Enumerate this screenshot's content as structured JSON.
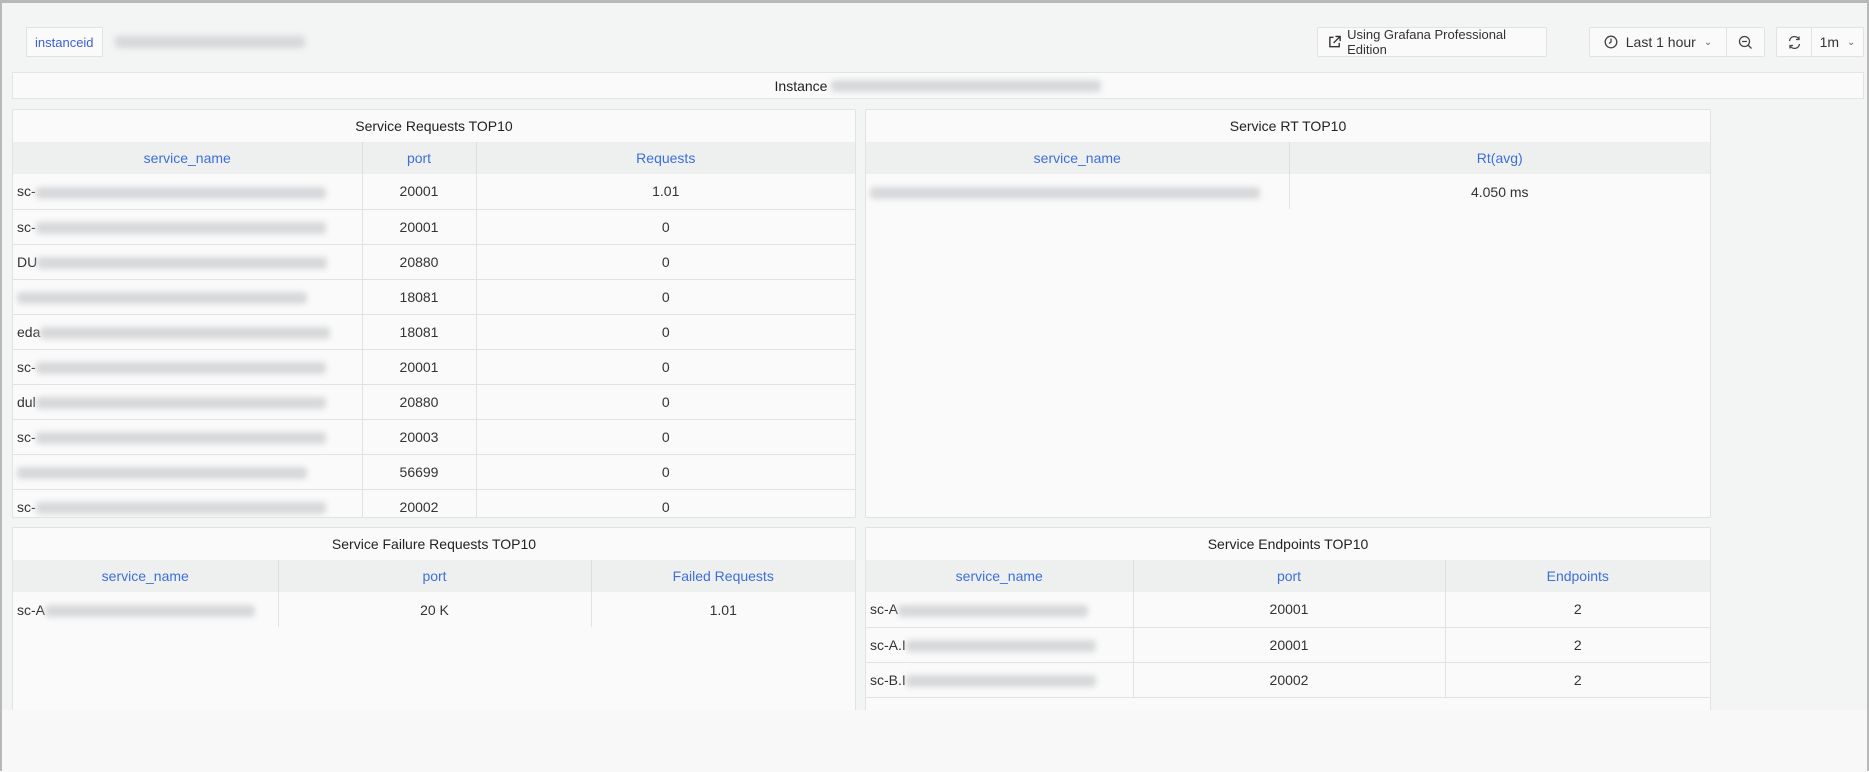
{
  "variables": {
    "label": "instanceid"
  },
  "toolbar": {
    "grafana_label": "Using Grafana Professional Edition",
    "time_range": "Last 1 hour",
    "refresh_interval": "1m"
  },
  "instance_row": {
    "label": "Instance"
  },
  "requests": {
    "title": "Service Requests TOP10",
    "headers": [
      "service_name",
      "port",
      "Requests"
    ],
    "rows": [
      {
        "prefix": "sc-",
        "port": "20001",
        "value": "1.01"
      },
      {
        "prefix": "sc-",
        "port": "20001",
        "value": "0"
      },
      {
        "prefix": "DU",
        "port": "20880",
        "value": "0"
      },
      {
        "prefix": "",
        "port": "18081",
        "value": "0"
      },
      {
        "prefix": "eda",
        "port": "18081",
        "value": "0"
      },
      {
        "prefix": "sc-",
        "port": "20001",
        "value": "0"
      },
      {
        "prefix": "dul",
        "port": "20880",
        "value": "0"
      },
      {
        "prefix": "sc-",
        "port": "20003",
        "value": "0"
      },
      {
        "prefix": "",
        "port": "56699",
        "value": "0"
      },
      {
        "prefix": "sc-",
        "port": "20002",
        "value": "0"
      }
    ]
  },
  "rt": {
    "title": "Service RT TOP10",
    "headers": [
      "service_name",
      "Rt(avg)"
    ],
    "rows": [
      {
        "prefix": "",
        "value": "4.050 ms"
      }
    ]
  },
  "failures": {
    "title": "Service Failure Requests TOP10",
    "headers": [
      "service_name",
      "port",
      "Failed Requests"
    ],
    "rows": [
      {
        "prefix": "sc-A",
        "port": "20 K",
        "value": "1.01"
      }
    ]
  },
  "endpoints": {
    "title": "Service Endpoints TOP10",
    "headers": [
      "service_name",
      "port",
      "Endpoints"
    ],
    "rows": [
      {
        "prefix": "sc-A",
        "port": "20001",
        "value": "2"
      },
      {
        "prefix": "sc-A.I",
        "port": "20001",
        "value": "2"
      },
      {
        "prefix": "sc-B.I",
        "port": "20002",
        "value": "2"
      }
    ]
  },
  "colors": {
    "header_text": "#3d6fd9",
    "panel_bg": "#fafafa",
    "page_bg": "#f3f4f4"
  }
}
